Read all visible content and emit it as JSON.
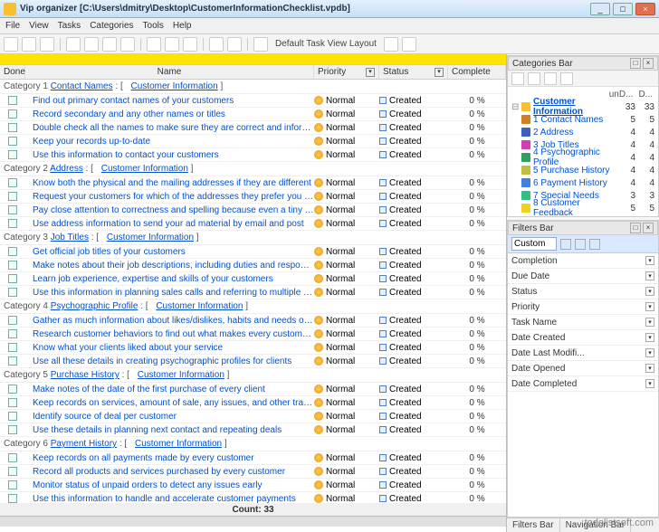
{
  "titlebar": {
    "app": "Vip organizer",
    "path": "[C:\\Users\\dmitry\\Desktop\\CustomerInformationChecklist.vpdb]"
  },
  "menu": [
    "File",
    "View",
    "Tasks",
    "Categories",
    "Tools",
    "Help"
  ],
  "toolbar": {
    "layout_label": "Default Task View Layout"
  },
  "columns": {
    "done": "Done",
    "name": "Name",
    "priority": "Priority",
    "status": "Status",
    "complete": "Complete"
  },
  "default_priority": "Normal",
  "default_status": "Created",
  "default_complete": "0 %",
  "count_label": "Count:",
  "count_value": "33",
  "categories": [
    {
      "idx": "1",
      "name": "Contact Names",
      "info": "Customer Information",
      "tasks": [
        "Find out primary contact names of your customers",
        "Record secondary and any other names or titles",
        "Double check all the names to make sure they are correct and informative",
        "Keep your records up-to-date",
        "Use this information to contact your customers"
      ]
    },
    {
      "idx": "2",
      "name": "Address",
      "info": "Customer Information",
      "tasks": [
        "Know both the physical and the mailing addresses if they are different",
        "Request your customers for which of the addresses they prefer you to send them anything to",
        "Pay close attention to correctness and spelling because even a tiny mistake in address line will fail delivery of your",
        "Use address information to send your ad material by email and post"
      ]
    },
    {
      "idx": "3",
      "name": "Job Titles",
      "info": "Customer Information",
      "tasks": [
        "Get official job titles of your customers",
        "Make notes about their job descriptions, including duties and responsibilities",
        "Learn job experience, expertise and skills of your customers",
        "Use this information in planning sales calls and referring to multiple people in the same company"
      ]
    },
    {
      "idx": "4",
      "name": "Psychographic Profile",
      "info": "Customer Information",
      "tasks": [
        "Gather as much information about likes/dislikes, habits and needs of your prospects and customers as possible",
        "Research customer behaviors to find out what makes every customer purchase from your company",
        "Know what your clients liked about your service",
        "Use all these details in creating psychographic profiles for clients"
      ]
    },
    {
      "idx": "5",
      "name": "Purchase History",
      "info": "Customer Information",
      "tasks": [
        "Make notes of the date of the first purchase of every client",
        "Keep records on services, amount of sale, any issues, and other transactional information per customer",
        "Identify source of deal per customer",
        "Use these details in planning next contact and repeating deals"
      ]
    },
    {
      "idx": "6",
      "name": "Payment History",
      "info": "Customer Information",
      "tasks": [
        "Keep records on all payments made by every customer",
        "Record all products and services purchased by every customer",
        "Monitor status of unpaid orders to detect any issues early",
        "Use this information to handle and accelerate customer payments"
      ]
    }
  ],
  "cat_panel": {
    "title": "Categories Bar",
    "hdr1": "unD...",
    "hdr2": "D...",
    "items": [
      {
        "name": "Customer Information",
        "n1": "33",
        "n2": "33",
        "bold": true,
        "color": "#f8c030"
      },
      {
        "name": "1 Contact Names",
        "n1": "5",
        "n2": "5",
        "color": "#d08020"
      },
      {
        "name": "2 Address",
        "n1": "4",
        "n2": "4",
        "color": "#4060c0"
      },
      {
        "name": "3 Job Titles",
        "n1": "4",
        "n2": "4",
        "color": "#d040b0"
      },
      {
        "name": "4 Psychographic Profile",
        "n1": "4",
        "n2": "4",
        "color": "#30a060"
      },
      {
        "name": "5 Purchase History",
        "n1": "4",
        "n2": "4",
        "color": "#c0c040"
      },
      {
        "name": "6 Payment History",
        "n1": "4",
        "n2": "4",
        "color": "#4080e0"
      },
      {
        "name": "7 Special Needs",
        "n1": "3",
        "n2": "3",
        "color": "#30c080"
      },
      {
        "name": "8 Customer Feedback",
        "n1": "5",
        "n2": "5",
        "color": "#f0d020"
      }
    ]
  },
  "filters_panel": {
    "title": "Filters Bar",
    "custom": "Custom",
    "rows": [
      "Completion",
      "Due Date",
      "Status",
      "Priority",
      "Task Name",
      "Date Created",
      "Date Last Modifi...",
      "Date Opened",
      "Date Completed"
    ]
  },
  "bottom_tabs": [
    "Filters Bar",
    "Navigation Bar"
  ],
  "watermark": "todolistsoft.com"
}
